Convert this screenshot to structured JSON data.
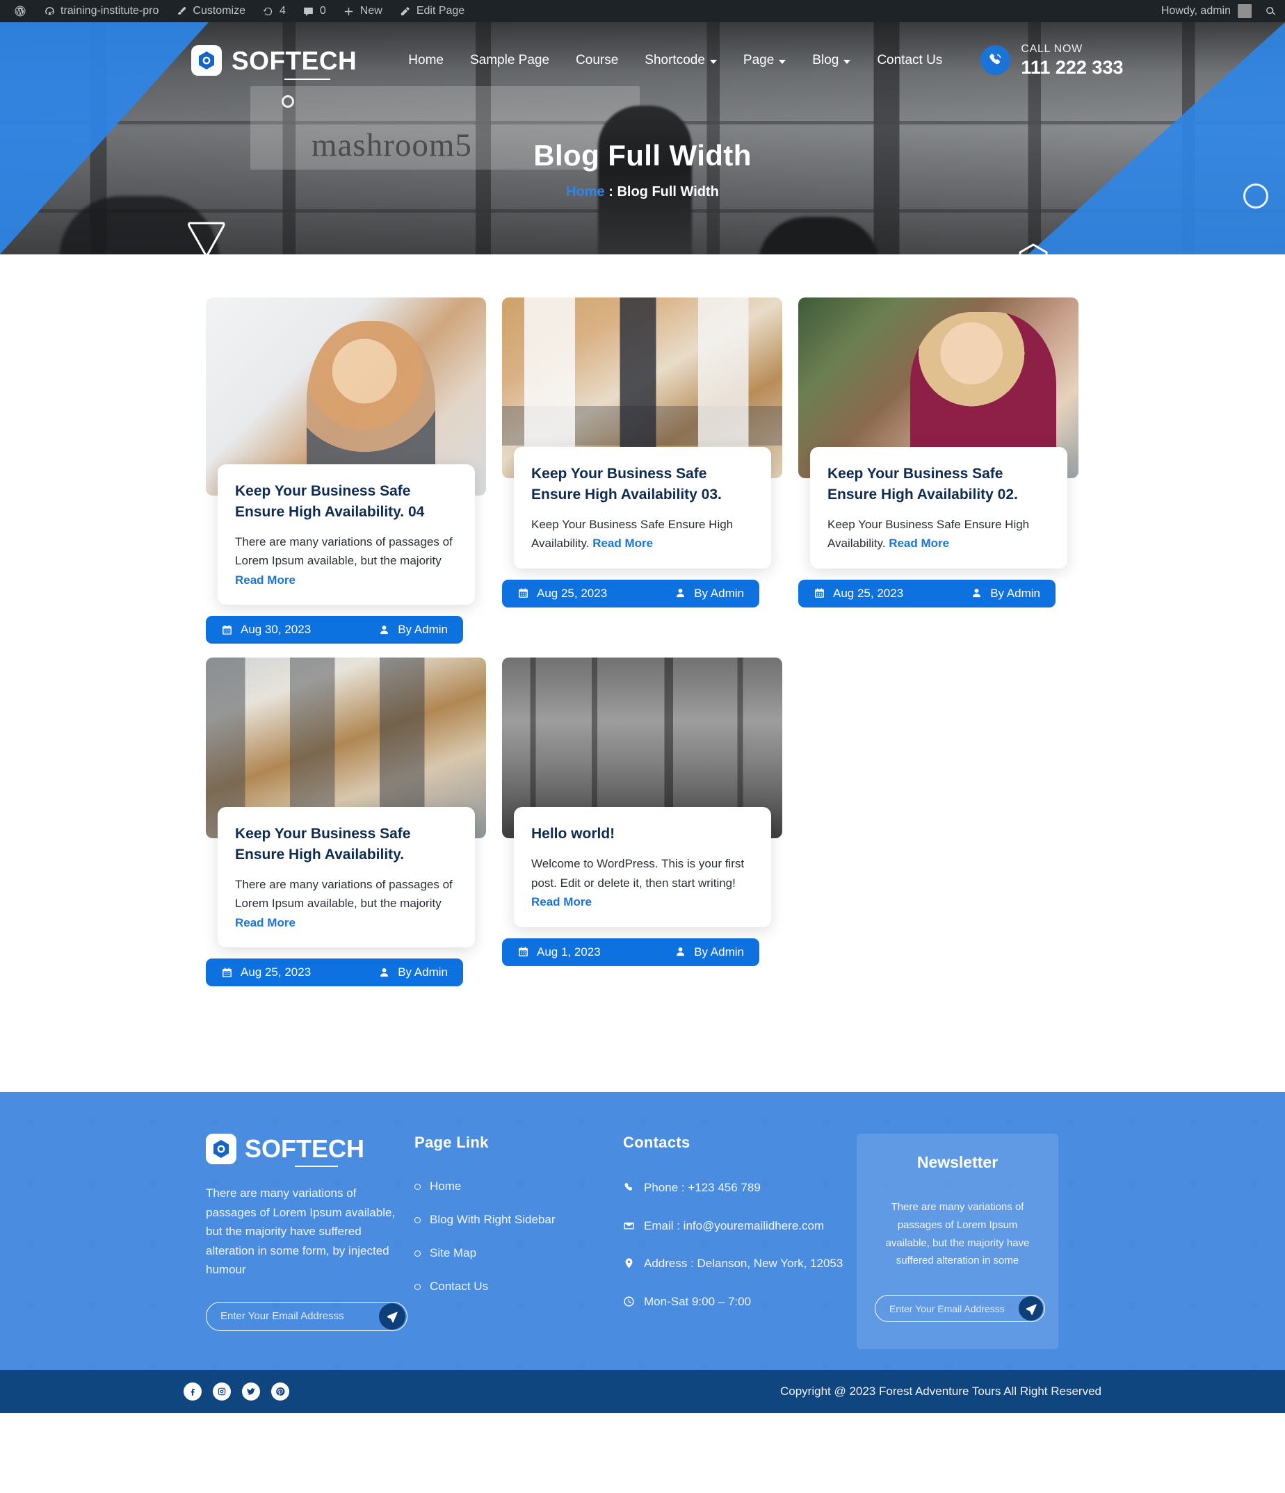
{
  "adminbar": {
    "items": [
      {
        "icon": "wordpress-logo-icon",
        "label": ""
      },
      {
        "icon": "dashboard-icon",
        "label": "training-institute-pro"
      },
      {
        "icon": "brush-icon",
        "label": "Customize"
      },
      {
        "icon": "updates-icon",
        "label": "4"
      },
      {
        "icon": "comment-icon",
        "label": "0"
      },
      {
        "icon": "plus-icon",
        "label": "New"
      },
      {
        "icon": "pencil-icon",
        "label": "Edit Page"
      }
    ],
    "howdy": "Howdy, admin",
    "search_icon": "search-icon"
  },
  "header": {
    "brand": "SOFTECH",
    "nav": [
      {
        "label": "Home",
        "has_caret": false
      },
      {
        "label": "Sample Page",
        "has_caret": false
      },
      {
        "label": "Course",
        "has_caret": false
      },
      {
        "label": "Shortcode",
        "has_caret": true
      },
      {
        "label": "Page",
        "has_caret": true
      },
      {
        "label": "Blog",
        "has_caret": true
      },
      {
        "label": "Contact Us",
        "has_caret": false
      }
    ],
    "call_label": "CALL NOW",
    "call_number": "111 222 333"
  },
  "hero": {
    "title": "Blog Full Width",
    "crumb_home": "Home",
    "crumb_sep": ":",
    "crumb_current": "Blog Full Width",
    "board_text": "mashroom5"
  },
  "posts": [
    {
      "title": "Keep Your Business Safe Ensure High Availability. 04",
      "excerpt": "There are many variations of passages of Lorem Ipsum available, but the majority",
      "read_more": "Read More",
      "date": "Aug 30, 2023",
      "author": "By Admin",
      "photo": "p1"
    },
    {
      "title": "Keep Your Business Safe Ensure High Availability 03.",
      "excerpt": "Keep Your Business Safe Ensure High Availability.",
      "read_more": "Read More",
      "date": "Aug 25, 2023",
      "author": "By Admin",
      "photo": "p2"
    },
    {
      "title": "Keep Your Business Safe Ensure High Availability 02.",
      "excerpt": "Keep Your Business Safe Ensure High Availability.",
      "read_more": "Read More",
      "date": "Aug 25, 2023",
      "author": "By Admin",
      "photo": "p3"
    },
    {
      "title": "Keep Your Business Safe Ensure High Availability.",
      "excerpt": "There are many variations of passages of Lorem Ipsum available, but the majority",
      "read_more": "Read More",
      "date": "Aug 25, 2023",
      "author": "By Admin",
      "photo": "p4"
    },
    {
      "title": "Hello world!",
      "excerpt": "Welcome to WordPress. This is your first post. Edit or delete it, then start writing!",
      "read_more": "Read More",
      "date": "Aug 1, 2023",
      "author": "By Admin",
      "photo": "p5"
    }
  ],
  "footer": {
    "brand": "SOFTECH",
    "about": "There are many variations of passages of Lorem Ipsum available, but the majority have suffered alteration in some form, by injected humour",
    "email_placeholder": "Enter Your Email Addresss",
    "pagelink_head": "Page Link",
    "pagelinks": [
      {
        "label": "Home"
      },
      {
        "label": "Blog With Right Sidebar"
      },
      {
        "label": "Site Map"
      },
      {
        "label": "Contact Us"
      }
    ],
    "contacts_head": "Contacts",
    "contacts": [
      {
        "icon": "phone-icon",
        "text": "Phone : +123 456 789"
      },
      {
        "icon": "envelope-icon",
        "text": "Email : info@youremailidhere.com"
      },
      {
        "icon": "map-pin-icon",
        "text": "Address : Delanson, New York, 12053"
      },
      {
        "icon": "clock-icon",
        "text": "Mon-Sat 9:00 – 7:00"
      }
    ],
    "newsletter_head": "Newsletter",
    "newsletter_text": "There are many variations of passages of Lorem Ipsum available, but the majority have suffered alteration in some",
    "newsletter_placeholder": "Enter Your Email Addresss"
  },
  "copyright": {
    "text": "Copyright @ 2023 Forest Adventure Tours All Right Reserved",
    "socials": [
      "facebook-icon",
      "instagram-icon",
      "twitter-icon",
      "pinterest-icon"
    ]
  },
  "colors": {
    "accent": "#2e86e8",
    "button": "#0d72e0",
    "dark_navy": "#0f2b52",
    "footer_bg": "#4a8ce0",
    "copybar_bg": "#0f467f",
    "adminbar_bg": "#1d2327"
  }
}
